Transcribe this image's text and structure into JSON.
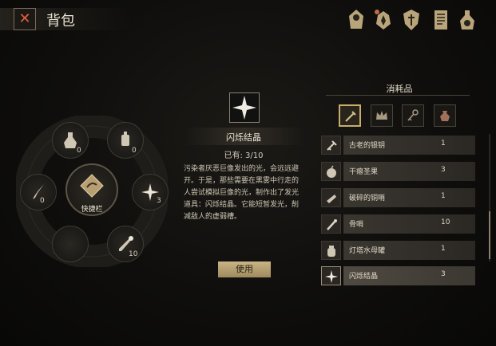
{
  "header": {
    "close_glyph": "✕",
    "title": "背包"
  },
  "top_icons": [
    "character-icon",
    "skills-icon",
    "shield-crest-icon",
    "journal-icon",
    "potion-bag-icon"
  ],
  "wheel": {
    "center_label": "快捷栏",
    "slots": [
      {
        "name": "potion-slot",
        "count": "0"
      },
      {
        "name": "lantern-slot",
        "count": "0"
      },
      {
        "name": "dagger-slot",
        "count": "0"
      },
      {
        "name": "crystal-slot",
        "count": "3"
      },
      {
        "name": "empty-slot",
        "count": ""
      },
      {
        "name": "scepter-slot",
        "count": "10"
      }
    ]
  },
  "detail": {
    "name": "闪烁结晶",
    "owned": "已有: 3/10",
    "description": "污染者厌恶巨像发出的光，会远远避开。于是，那些需要在黑雾中行走的人尝试模拟巨像的光，制作出了发光道具：闪烁结晶。它能短暂发光，削减敌人的虚弱槽。",
    "use_label": "使用"
  },
  "consumables": {
    "title": "消耗品",
    "tabs": [
      "lamp-tab-icon",
      "crown-tab-icon",
      "key-tab-icon",
      "pouch-tab-icon"
    ],
    "items": [
      {
        "name": "古老的银钥",
        "qty": "1",
        "icon": "key-icon"
      },
      {
        "name": "干瘪圣果",
        "qty": "3",
        "icon": "fruit-icon"
      },
      {
        "name": "破碎的铜哨",
        "qty": "1",
        "icon": "broken-whistle-icon"
      },
      {
        "name": "骨哨",
        "qty": "10",
        "icon": "bone-whistle-icon"
      },
      {
        "name": "灯塔水母罐",
        "qty": "1",
        "icon": "jar-icon"
      },
      {
        "name": "闪烁结晶",
        "qty": "3",
        "icon": "crystal-icon"
      }
    ]
  },
  "colors": {
    "accent_gold": "#c9ad6a",
    "close_red": "#e2603a"
  }
}
